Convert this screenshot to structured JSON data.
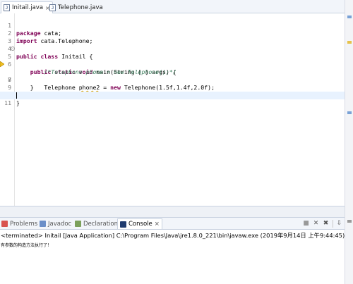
{
  "editor_tabs": [
    {
      "label": "Initail.java",
      "close": "⨯",
      "active": true
    },
    {
      "label": "Telephone.java",
      "active": false
    }
  ],
  "code_lines": [
    {
      "num": "1",
      "text": "package cata;"
    },
    {
      "num": "2",
      "text": "import cata.Telephone;"
    },
    {
      "num": "3",
      "text": ""
    },
    {
      "num": "4",
      "text": "public class Initail {"
    },
    {
      "num": "5",
      "text": "    public static void main(String [ ] args) {"
    },
    {
      "num": "6",
      "text": "        /*Telephone phone = new Telephone();*/"
    },
    {
      "num": "7",
      "text": "        Telephone phone2 = new Telephone(1.5f,1.4f,2.0f);"
    },
    {
      "num": "8",
      "text": "    }"
    },
    {
      "num": "9",
      "text": ""
    },
    {
      "num": "10",
      "text": "}"
    },
    {
      "num": "11",
      "text": ""
    }
  ],
  "view_tabs": [
    {
      "label": "Problems"
    },
    {
      "label": "Javadoc"
    },
    {
      "label": "Declaration"
    },
    {
      "label": "Console",
      "close": "⨯",
      "active": true
    }
  ],
  "console": {
    "status": "<terminated> Initail [Java Application] C:\\Program Files\\Java\\jre1.8.0_221\\bin\\javaw.exe (2019年9月14日 上午9:44:45)",
    "output": "有参数的构造方法执行了！"
  },
  "colors": {
    "keyword": "#7f0055",
    "comment": "#3f7f5f",
    "current_line": "#e8f2fe",
    "warning": "#d6a200"
  },
  "icons": [
    "java-file-icon",
    "problems-icon",
    "javadoc-icon",
    "declaration-icon",
    "console-icon",
    "terminate-icon",
    "remove-launch-icon",
    "remove-all-icon",
    "scroll-lock-icon"
  ]
}
